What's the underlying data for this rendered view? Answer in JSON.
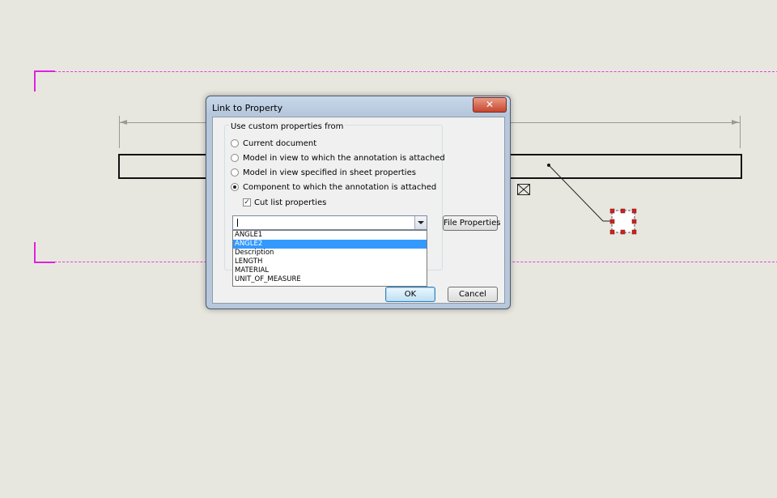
{
  "dialog": {
    "title": "Link to Property",
    "close_symbol": "✕",
    "group_label": "Use custom properties from",
    "radios": [
      {
        "label": "Current document",
        "checked": false
      },
      {
        "label": "Model in view to which the annotation is attached",
        "checked": false
      },
      {
        "label": "Model in view specified in sheet properties",
        "checked": false
      },
      {
        "label": "Component to which the annotation is attached",
        "checked": true
      }
    ],
    "cut_list": {
      "label": "Cut list properties",
      "checked": true,
      "mark": "✓"
    },
    "property_combo": {
      "value": ""
    },
    "dropdown_items": [
      "ANGLE1",
      "ANGLE2",
      "Description",
      "LENGTH",
      "MATERIAL",
      "UNIT_OF_MEASURE"
    ],
    "dropdown_selected": "ANGLE2",
    "file_properties_label": "File Properties",
    "ok_label": "OK",
    "cancel_label": "Cancel"
  },
  "colors": {
    "background": "#e8e7df",
    "sheet_border": "#e020e0",
    "selection": "#3399ff",
    "handle": "#cc2222"
  }
}
